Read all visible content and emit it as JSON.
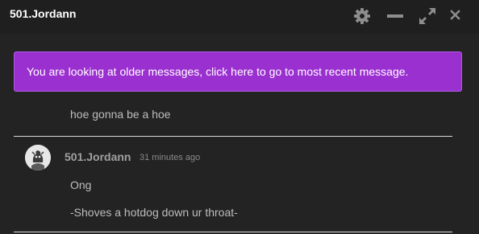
{
  "window": {
    "title": "501.Jordann",
    "icons": {
      "settings": "gear-icon",
      "minimize": "minimize-icon",
      "expand": "expand-icon",
      "close": "close-icon"
    }
  },
  "banner": {
    "text": "You are looking at older messages, click here to go to most recent message.",
    "color": "#9b30d0"
  },
  "messages": {
    "previous": "hoe gonna be a hoe",
    "group": {
      "author": "501.Jordann",
      "timestamp": "31 minutes ago",
      "lines": [
        "Ong",
        "-Shoves a hotdog down ur throat-"
      ]
    }
  }
}
